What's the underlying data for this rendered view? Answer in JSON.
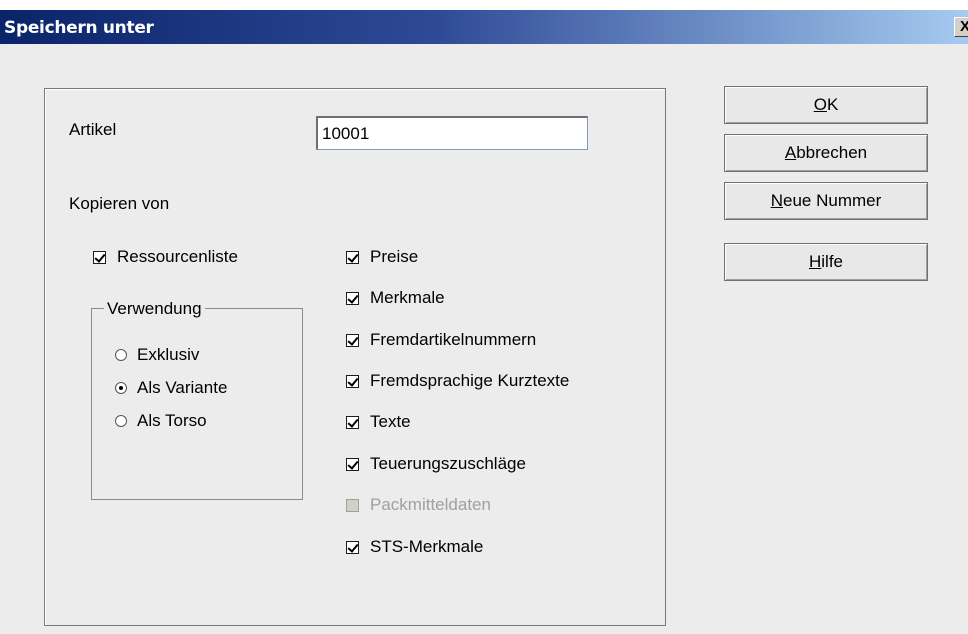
{
  "window": {
    "title": "Speichern unter",
    "close_glyph": "X"
  },
  "form": {
    "artikel_label": "Artikel",
    "artikel_value": "10001",
    "kopieren_label": "Kopieren von",
    "ressourcenliste": {
      "label": "Ressourcenliste",
      "checked": true
    },
    "verwendung": {
      "legend": "Verwendung",
      "options": [
        {
          "label": "Exklusiv",
          "selected": false
        },
        {
          "label": "Als Variante",
          "selected": true
        },
        {
          "label": "Als Torso",
          "selected": false
        }
      ]
    },
    "checkboxes": [
      {
        "label": "Preise",
        "checked": true,
        "enabled": true
      },
      {
        "label": "Merkmale",
        "checked": true,
        "enabled": true
      },
      {
        "label": "Fremdartikelnummern",
        "checked": true,
        "enabled": true
      },
      {
        "label": "Fremdsprachige Kurztexte",
        "checked": true,
        "enabled": true
      },
      {
        "label": "Texte",
        "checked": true,
        "enabled": true
      },
      {
        "label": "Teuerungszuschläge",
        "checked": true,
        "enabled": true
      },
      {
        "label": "Packmitteldaten",
        "checked": false,
        "enabled": false
      },
      {
        "label": "STS-Merkmale",
        "checked": true,
        "enabled": true
      }
    ]
  },
  "buttons": {
    "ok": {
      "mnemonic": "O",
      "rest": "K"
    },
    "abbrechen": {
      "mnemonic": "A",
      "rest": "bbrechen"
    },
    "neue_nummer": {
      "mnemonic": "N",
      "rest": "eue Nummer"
    },
    "hilfe": {
      "mnemonic": "H",
      "rest": "ilfe"
    }
  }
}
